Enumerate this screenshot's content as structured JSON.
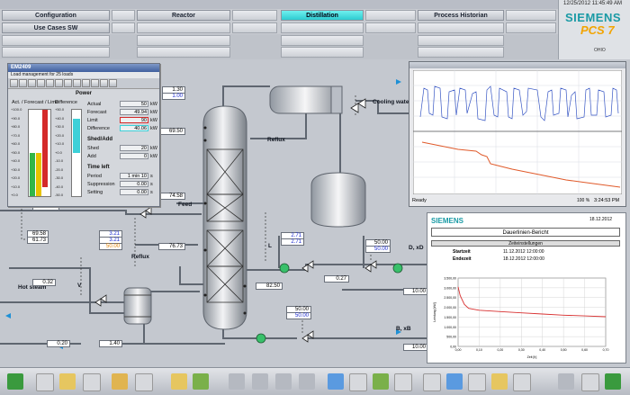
{
  "header": {
    "datetime": "12/25/2012  11:45:49 AM",
    "brand": "SIEMENS",
    "product": "PCS 7",
    "plant": "OHIO",
    "nav_row1": [
      {
        "label": "Configuration",
        "active": false
      },
      {
        "label": "Reactor",
        "active": false
      },
      {
        "label": "Distillation",
        "active": true
      },
      {
        "label": "Process Historian",
        "active": false
      }
    ],
    "nav_row2": [
      {
        "label": "Use Cases SW",
        "active": false
      }
    ]
  },
  "faceplate": {
    "title": "EM2409",
    "subtitle": "Load management for 25 loads",
    "section_power": "Power",
    "bar_header": "Act. / Forecast / Limit",
    "diff_header": "Difference",
    "scale_left": [
      "+100.0",
      "+90.0",
      "+80.0",
      "+70.0",
      "+60.0",
      "+50.0",
      "+40.0",
      "+30.0",
      "+20.0",
      "+10.0",
      "+0.0"
    ],
    "scale_right": [
      "+50.0",
      "+40.0",
      "+30.0",
      "+20.0",
      "+10.0",
      "+0.0",
      "-10.0",
      "-20.0",
      "-30.0",
      "-40.0",
      "-50.0"
    ],
    "power": [
      {
        "label": "Actual",
        "value": "50",
        "unit": "kW"
      },
      {
        "label": "Forecast",
        "value": "49.94",
        "unit": "kW"
      },
      {
        "label": "Limit",
        "value": "90",
        "unit": "kW"
      },
      {
        "label": "Difference",
        "value": "40.06",
        "unit": "kW"
      }
    ],
    "section_shed": "Shed/Add",
    "shed": [
      {
        "label": "Shed",
        "value": "20",
        "unit": "kW"
      },
      {
        "label": "Add",
        "value": "0",
        "unit": "kW"
      }
    ],
    "section_time": "Time left",
    "time": [
      {
        "label": "Period",
        "value": "1 min  10",
        "unit": "s"
      },
      {
        "label": "Suppression",
        "value": "0.00",
        "unit": "s"
      },
      {
        "label": "Setting",
        "value": "0.00",
        "unit": "s"
      }
    ]
  },
  "process": {
    "labels": {
      "reflux_top": "Reflux",
      "cooling": "Cooling water",
      "feed": "Feed",
      "reflux_left": "Reflux",
      "hot_steam": "Hot steam",
      "dxd": "D, xD",
      "bxb": "B, xB",
      "l": "L",
      "v": "V"
    },
    "values": {
      "top_a": "1.30",
      "top_b": "1.00",
      "v6950": "69.50",
      "v7458": "74.58",
      "v7673": "76.73",
      "v8250": "82.50",
      "dl_a": "2.71",
      "dl_b": "2.71",
      "dr_a": "50.00",
      "dr_b": "50.00",
      "v027": "0.27",
      "v1000a": "10.00",
      "v1000b": "10.00",
      "btm_a": "50.00",
      "btm_b": "50.00",
      "left_a": "69.58",
      "left_b": "61.73",
      "left_c": "3.21",
      "left_d": "3.21",
      "left_e": "50.00",
      "v032": "0.32",
      "v020": "0.20",
      "v140": "1.40",
      "v000": "0.00"
    }
  },
  "trend": {
    "status": "Ready",
    "time": "3:24:53 PM",
    "percent": "100 %"
  },
  "report": {
    "brand": "SIEMENS",
    "date": "18.12.2012",
    "title": "Dauerlinien-Bericht",
    "section": "Zeiteinstellungen",
    "start_label": "Startzeit",
    "start_value": "11.12.2012 12:00:00",
    "end_label": "Endezeit",
    "end_value": "18.12.2012 12:00:00",
    "y_axis_label": "Leistung [kW]",
    "x_axis_label": "Zeit [h]",
    "y_ticks": [
      "3.500,00",
      "3.000,00",
      "2.500,00",
      "2.000,00",
      "1.500,00",
      "1.000,00",
      "500,00",
      "0,00"
    ],
    "x_ticks": [
      "0,00",
      "0,10",
      "0,20",
      "0,30",
      "0,40",
      "0,50",
      "0,60",
      "0,70"
    ]
  },
  "chart_data": [
    {
      "type": "line",
      "title": "",
      "ylim": [
        0,
        3500
      ],
      "x": [
        0.0,
        0.01,
        0.03,
        0.05,
        0.1,
        0.2,
        0.3,
        0.4,
        0.5,
        0.6,
        0.7
      ],
      "series": [
        {
          "values": [
            3050,
            2600,
            2150,
            1950,
            1850,
            1780,
            1720,
            1660,
            1600,
            1560,
            1520
          ]
        }
      ],
      "xlabel": "Zeit [h]",
      "ylabel": "Leistung [kW]",
      "colors": [
        "#d83030"
      ]
    }
  ],
  "colors": {
    "accent": "#2ecbd0",
    "brand": "#1a9aa5",
    "product": "#f2a400"
  }
}
